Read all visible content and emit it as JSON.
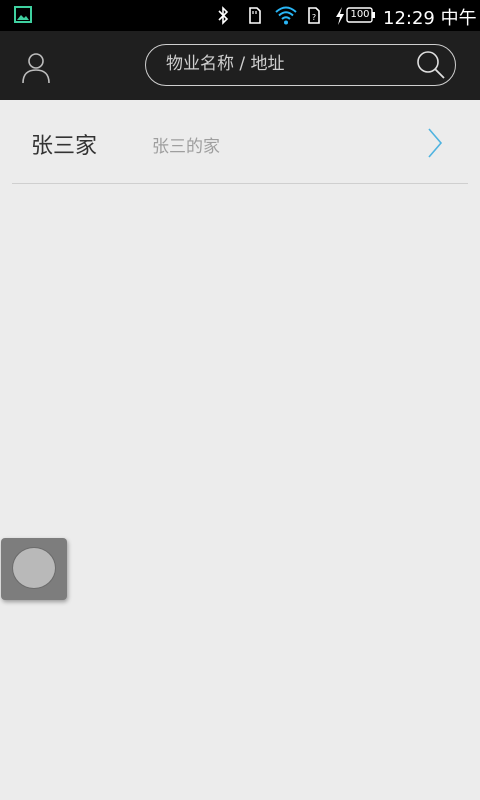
{
  "status_bar": {
    "time": "12:29 中午",
    "battery": "100",
    "icons": [
      "gallery-icon",
      "bluetooth-icon",
      "sd-card-icon",
      "wifi-icon",
      "sim-card-icon",
      "charging-icon",
      "battery-icon"
    ]
  },
  "header": {
    "search_placeholder": "物业名称 / 地址",
    "icons": [
      "user-icon",
      "search-icon"
    ],
    "colors": {
      "background": "#1f1f1f",
      "border": "#cfcfcf"
    }
  },
  "list": {
    "items": [
      {
        "title": "张三家",
        "subtitle": "张三的家"
      }
    ],
    "chevron_color": "#4fb3e0"
  },
  "floating_button": {
    "icon": "assistive-touch-icon"
  }
}
